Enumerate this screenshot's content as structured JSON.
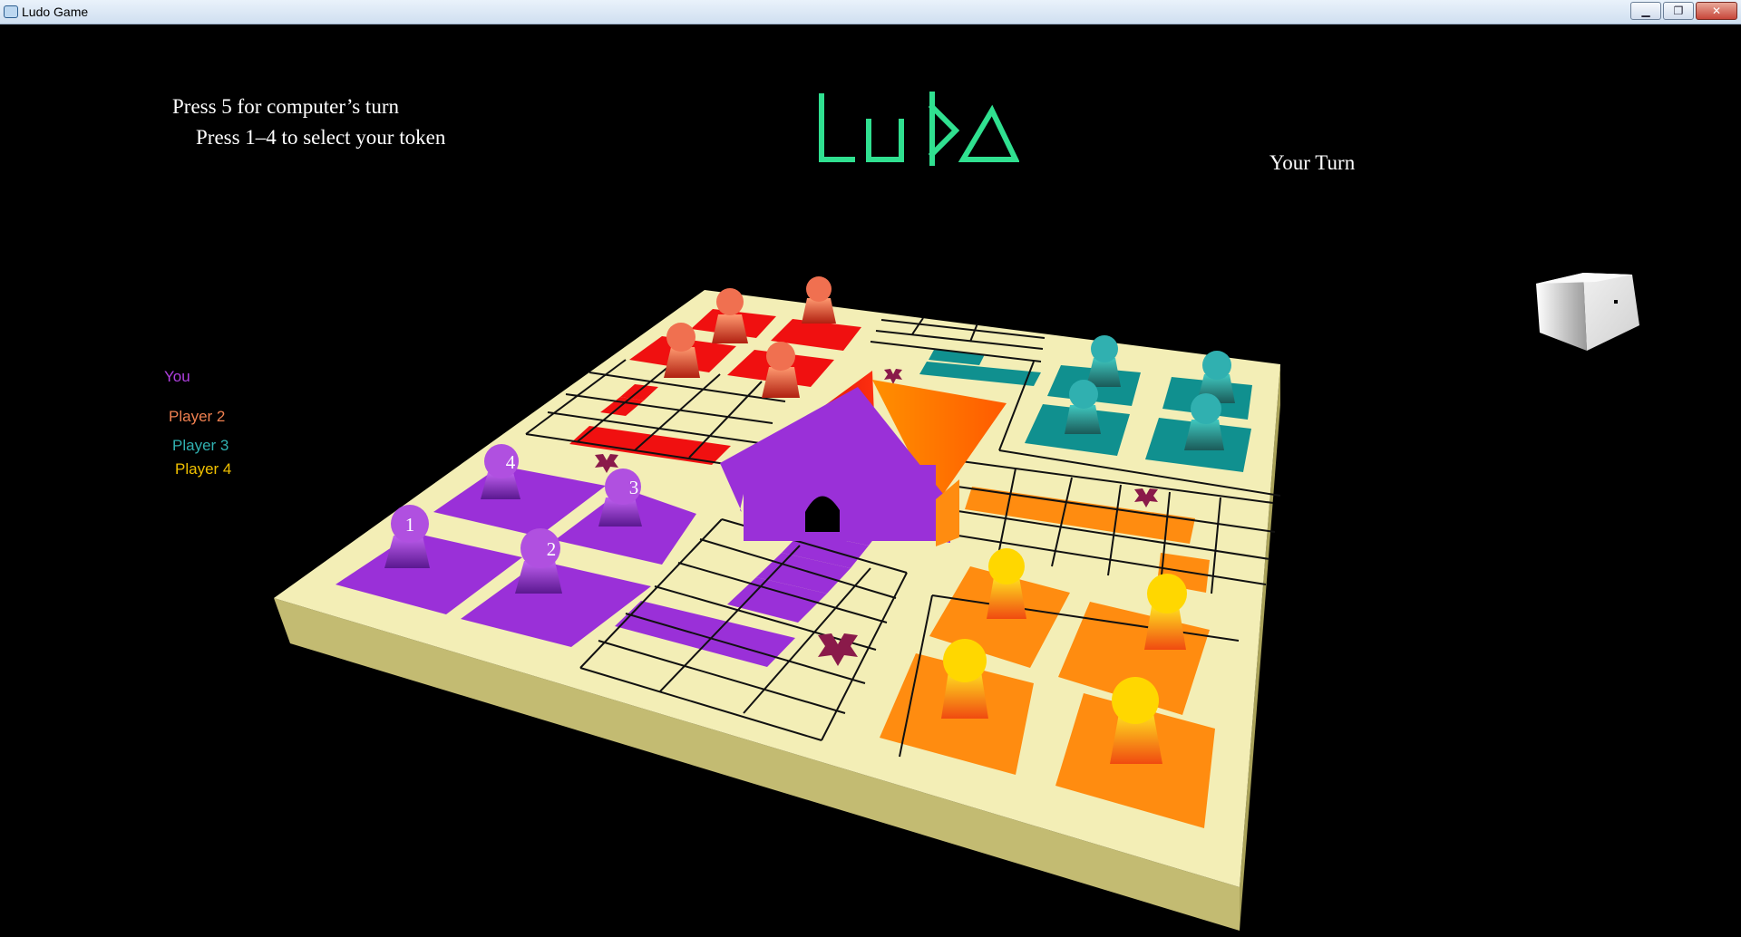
{
  "window": {
    "title": "Ludo Game",
    "minimize": "▁",
    "maximize": "❐",
    "close": "✕"
  },
  "logo": "Ludo",
  "instructions": {
    "line1": "Press 5 for computer’s turn",
    "line2": "Press 1–4 to select your token"
  },
  "status": {
    "turn": "Your Turn"
  },
  "players": [
    {
      "name": "You",
      "color": "#b040e0"
    },
    {
      "name": "Player 2",
      "color": "#f08050"
    },
    {
      "name": "Player 3",
      "color": "#30b0b0"
    },
    {
      "name": "Player 4",
      "color": "#f0c000"
    }
  ],
  "tokens": {
    "you": [
      "1",
      "2",
      "3",
      "4"
    ]
  },
  "colors": {
    "board": "#f3eeb6",
    "board_side": "#c3bb72",
    "purple": "#9a30d8",
    "red": "#f01010",
    "teal": "#10908f",
    "orange": "#ff8c10",
    "star": "#8a1a4a",
    "logo": "#30e090"
  },
  "dice": {
    "icon": "die-one-pip"
  }
}
